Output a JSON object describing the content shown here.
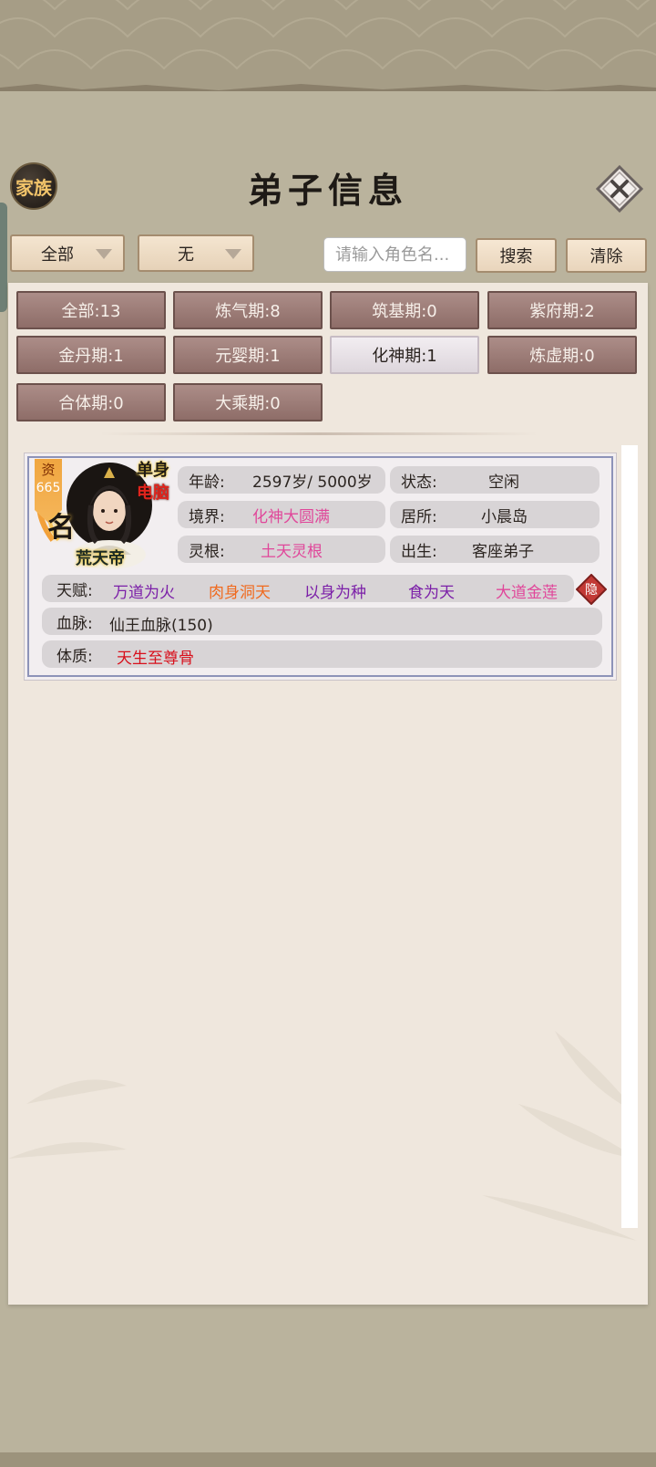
{
  "header": {
    "title": "弟子信息",
    "family_button": "家族",
    "close_icon": "close-x-diamond"
  },
  "filters": {
    "dropdown1": "全部",
    "dropdown2": "无",
    "search_placeholder": "请输入角色名...",
    "search_button": "搜索",
    "clear_button": "清除"
  },
  "realm_tabs": [
    {
      "label": "全部:13"
    },
    {
      "label": "炼气期:8"
    },
    {
      "label": "筑基期:0"
    },
    {
      "label": "紫府期:2"
    },
    {
      "label": "金丹期:1"
    },
    {
      "label": "元婴期:1"
    },
    {
      "label": "化神期:1",
      "active": true
    },
    {
      "label": "炼虚期:0"
    },
    {
      "label": "合体期:0"
    },
    {
      "label": "大乘期:0"
    }
  ],
  "disciple": {
    "quality_label": "资",
    "quality_value": "665",
    "tag_single": "单身",
    "tag_pc": "电脑",
    "name": "荒天帝",
    "fame_mark": "名",
    "age_label": "年龄:",
    "age_value": "2597岁/ 5000岁",
    "status_label": "状态:",
    "status_value": "空闲",
    "realm_label": "境界:",
    "realm_value": "化神大圆满",
    "residence_label": "居所:",
    "residence_value": "小晨岛",
    "root_label": "灵根:",
    "root_value": "土天灵根",
    "origin_label": "出生:",
    "origin_value": "客座弟子",
    "talent_label": "天赋:",
    "talents": [
      "万道为火",
      "肉身洞天",
      "以身为种",
      "食为天",
      "大道金莲"
    ],
    "hide_label": "隐",
    "bloodline_label": "血脉:",
    "bloodline_value": "仙王血脉(150)",
    "physique_label": "体质:",
    "physique_value": "天生至尊骨"
  },
  "colors": {
    "pink": "#e0479a",
    "purple": "#7b1fa8",
    "orange": "#f06a1e",
    "red": "#d8101c",
    "tab_bg": "#9c7b76"
  }
}
